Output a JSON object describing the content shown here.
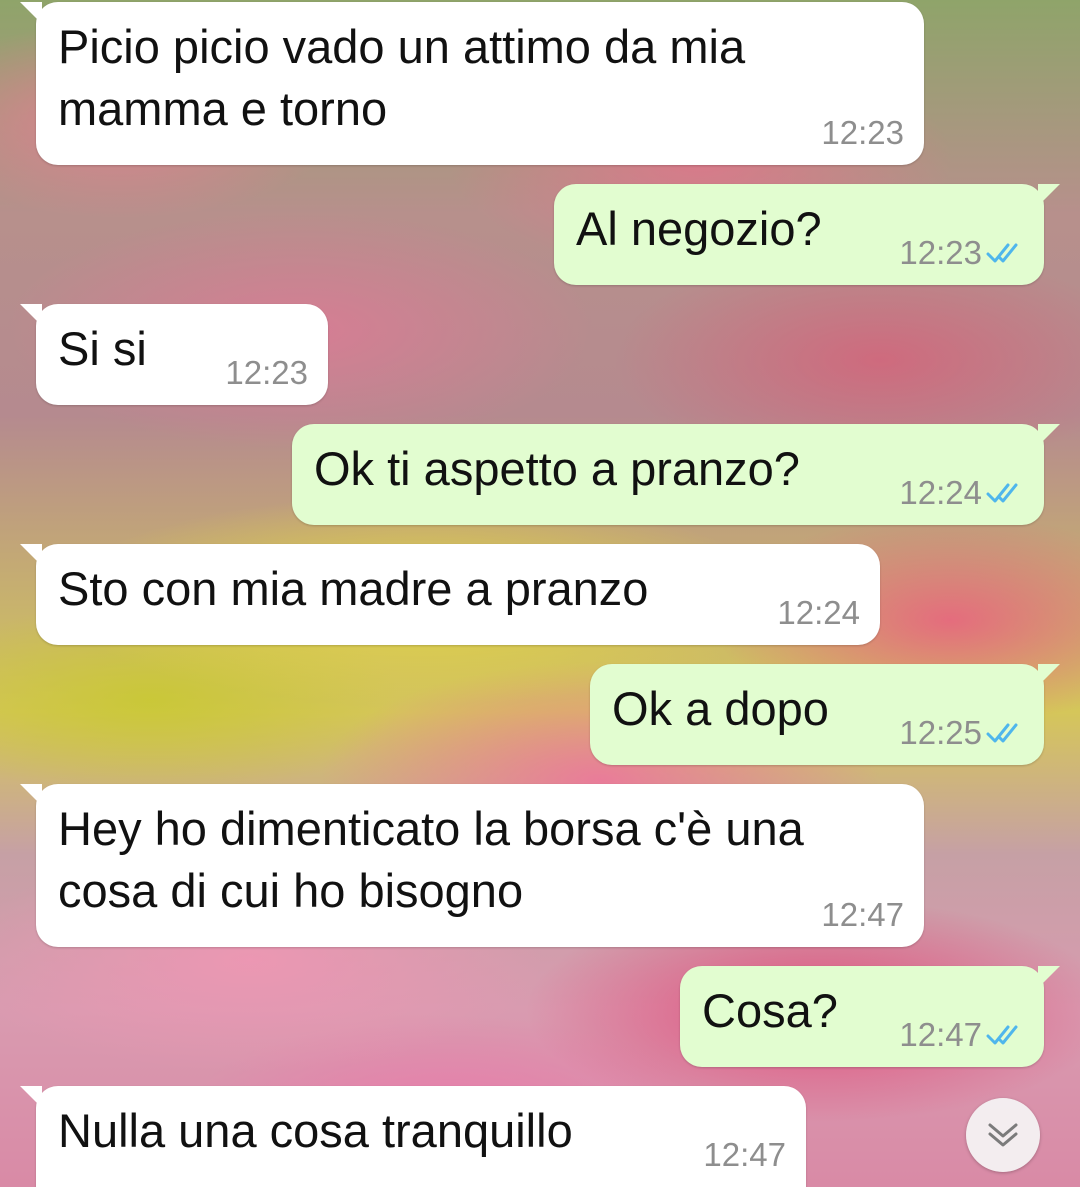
{
  "messages": [
    {
      "direction": "in",
      "lines": [
        "Picio picio vado un attimo da mia",
        "mamma e torno"
      ],
      "time": "12:23"
    },
    {
      "direction": "out",
      "lines": [
        "Al negozio?"
      ],
      "time": "12:23",
      "status": "read"
    },
    {
      "direction": "in",
      "lines": [
        "Si si"
      ],
      "time": "12:23"
    },
    {
      "direction": "out",
      "lines": [
        "Ok ti aspetto a pranzo?"
      ],
      "time": "12:24",
      "status": "read"
    },
    {
      "direction": "in",
      "lines": [
        "Sto con mia madre a pranzo"
      ],
      "time": "12:24"
    },
    {
      "direction": "out",
      "lines": [
        "Ok a dopo"
      ],
      "time": "12:25",
      "status": "read"
    },
    {
      "direction": "in",
      "lines": [
        "Hey ho dimenticato la borsa c'è una",
        "cosa di cui ho bisogno"
      ],
      "time": "12:47"
    },
    {
      "direction": "out",
      "lines": [
        "Cosa?"
      ],
      "time": "12:47",
      "status": "read"
    },
    {
      "direction": "in",
      "lines": [
        "Nulla una cosa tranquillo"
      ],
      "time": "12:47"
    }
  ],
  "colors": {
    "incoming": "#ffffff",
    "outgoing": "#e2fdd0",
    "read_check": "#4fb6ec",
    "time": "#8e8e8e"
  },
  "icons": {
    "read_receipt": "double-check-icon",
    "scroll_down": "double-chevron-down-icon"
  }
}
